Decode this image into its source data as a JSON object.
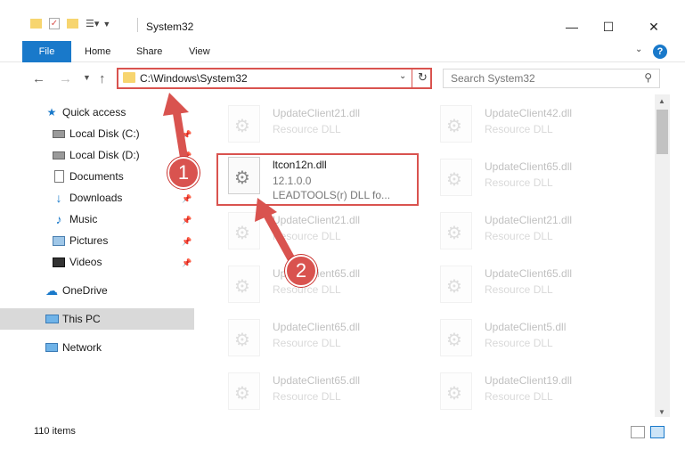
{
  "window": {
    "title": "System32",
    "minimize": "—",
    "maximize": "☐",
    "close": "✕"
  },
  "ribbon": {
    "file": "File",
    "home": "Home",
    "share": "Share",
    "view": "View",
    "help": "?"
  },
  "address": {
    "path": "C:\\Windows\\System32",
    "search_placeholder": "Search System32"
  },
  "sidebar": {
    "items": [
      {
        "label": "Quick access",
        "icon": "star-icon"
      },
      {
        "label": "Local Disk (C:)",
        "icon": "drive-icon"
      },
      {
        "label": "Local Disk (D:)",
        "icon": "drive-icon"
      },
      {
        "label": "Documents",
        "icon": "documents-icon"
      },
      {
        "label": "Downloads",
        "icon": "download-icon"
      },
      {
        "label": "Music",
        "icon": "music-icon"
      },
      {
        "label": "Pictures",
        "icon": "pictures-icon"
      },
      {
        "label": "Videos",
        "icon": "videos-icon"
      },
      {
        "label": "OneDrive",
        "icon": "cloud-icon"
      },
      {
        "label": "This PC",
        "icon": "computer-icon"
      },
      {
        "label": "Network",
        "icon": "network-icon"
      }
    ]
  },
  "files": {
    "left": [
      {
        "name": "UpdateClient21.dll",
        "type": "Resource DLL"
      },
      {
        "name": "ltcon12n.dll",
        "version": "12.1.0.0",
        "desc": "LEADTOOLS(r) DLL fo..."
      },
      {
        "name": "UpdateClient21.dll",
        "type": "Resource DLL"
      },
      {
        "name": "UpdateClient65.dll",
        "type": "Resource DLL"
      },
      {
        "name": "UpdateClient65.dll",
        "type": "Resource DLL"
      },
      {
        "name": "UpdateClient65.dll",
        "type": "Resource DLL"
      }
    ],
    "right": [
      {
        "name": "UpdateClient42.dll",
        "type": "Resource DLL"
      },
      {
        "name": "UpdateClient65.dll",
        "type": "Resource DLL"
      },
      {
        "name": "UpdateClient21.dll",
        "type": "Resource DLL"
      },
      {
        "name": "UpdateClient65.dll",
        "type": "Resource DLL"
      },
      {
        "name": "UpdateClient5.dll",
        "type": "Resource DLL"
      },
      {
        "name": "UpdateClient19.dll",
        "type": "Resource DLL"
      }
    ]
  },
  "status": {
    "count": "110 items"
  },
  "callouts": {
    "one": "1",
    "two": "2"
  },
  "colors": {
    "accent": "#1979ca",
    "callout": "#d9534f"
  }
}
